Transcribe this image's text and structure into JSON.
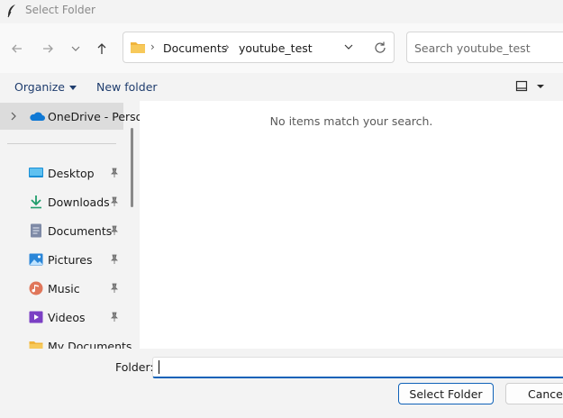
{
  "window": {
    "title": "Select Folder"
  },
  "nav": {
    "back_icon": "arrow-left-icon",
    "forward_icon": "arrow-right-icon",
    "recent_icon": "chevron-down-icon",
    "up_icon": "arrow-up-icon"
  },
  "address": {
    "crumbs": [
      "Documents",
      "youtube_test"
    ]
  },
  "search": {
    "placeholder": "Search youtube_test"
  },
  "toolbar": {
    "organize_label": "Organize",
    "new_folder_label": "New folder"
  },
  "sidebar": {
    "onedrive_label": "OneDrive - Personal",
    "items": [
      {
        "label": "Desktop",
        "icon": "desktop-icon"
      },
      {
        "label": "Downloads",
        "icon": "downloads-icon"
      },
      {
        "label": "Documents",
        "icon": "documents-icon"
      },
      {
        "label": "Pictures",
        "icon": "pictures-icon"
      },
      {
        "label": "Music",
        "icon": "music-icon"
      },
      {
        "label": "Videos",
        "icon": "videos-icon"
      },
      {
        "label": "My Documents",
        "icon": "folder-icon"
      }
    ]
  },
  "content": {
    "empty_message": "No items match your search."
  },
  "footer": {
    "folder_label": "Folder:",
    "folder_value": "",
    "select_label": "Select Folder",
    "cancel_label": "Cancel"
  },
  "colors": {
    "accent": "#0f62b8",
    "link": "#1f3d6e",
    "folder": "#f0b43c"
  }
}
